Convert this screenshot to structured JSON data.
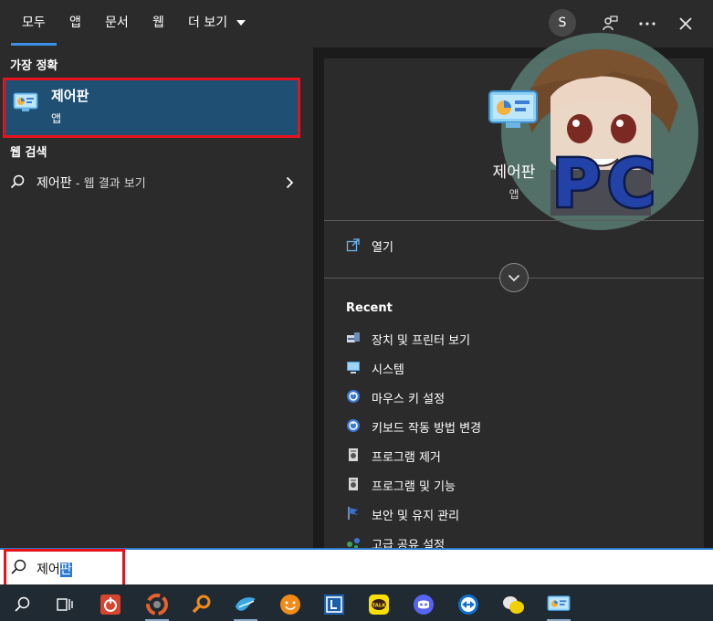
{
  "tabs": [
    "모두",
    "앱",
    "문서",
    "웹",
    "더 보기"
  ],
  "topbar": {
    "avatar_letter": "S"
  },
  "left": {
    "best_match_header": "가장 정확",
    "best_match": {
      "title": "제어판",
      "subtitle": "앱"
    },
    "web_header": "웹 검색",
    "web_result": {
      "query": "제어판",
      "suffix": " - 웹 결과 보기"
    }
  },
  "detail": {
    "title": "제어판",
    "subtitle": "앱",
    "open_label": "열기",
    "recent_header": "Recent",
    "recent_items": [
      "장치 및 프린터 보기",
      "시스템",
      "마우스 키 설정",
      "키보드 작동 방법 변경",
      "프로그램 제거",
      "프로그램 및 기능",
      "보안 및 유지 관리",
      "고급 공유 설정"
    ]
  },
  "search": {
    "typed": "제어",
    "selected": "판"
  },
  "taskbar_icons": [
    "search-icon",
    "task-view-icon",
    "power-app-icon",
    "media-app-icon",
    "search-tool-icon",
    "bird-app-icon",
    "smile-app-icon",
    "l-app-icon",
    "kakaotalk-icon",
    "discord-icon",
    "teamviewer-icon",
    "chat-bubbles-icon",
    "control-panel-icon"
  ],
  "colors": {
    "accent": "#3d8ee6",
    "highlight": "#1f4f72",
    "annotation": "#e8121d"
  }
}
